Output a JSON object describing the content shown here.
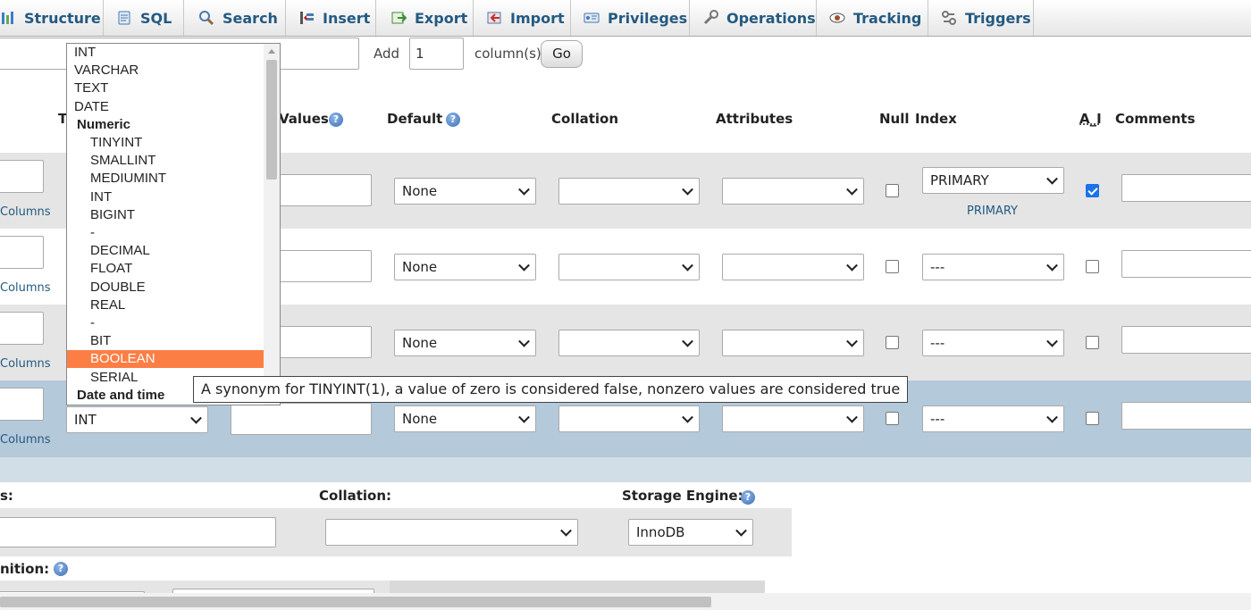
{
  "tabs": [
    {
      "label": "Structure",
      "icon": "structure-icon"
    },
    {
      "label": "SQL",
      "icon": "sql-icon"
    },
    {
      "label": "Search",
      "icon": "search-icon"
    },
    {
      "label": "Insert",
      "icon": "insert-icon"
    },
    {
      "label": "Export",
      "icon": "export-icon"
    },
    {
      "label": "Import",
      "icon": "import-icon"
    },
    {
      "label": "Privileges",
      "icon": "privileges-icon"
    },
    {
      "label": "Operations",
      "icon": "operations-icon"
    },
    {
      "label": "Tracking",
      "icon": "tracking-icon"
    },
    {
      "label": "Triggers",
      "icon": "triggers-icon"
    }
  ],
  "add_columns": {
    "label": "Add",
    "value": "1",
    "suffix": "column(s)",
    "go": "Go"
  },
  "headers": {
    "type": "T",
    "values": "Values",
    "default": "Default",
    "collation": "Collation",
    "attributes": "Attributes",
    "null": "Null",
    "index": "Index",
    "ai": "A_I",
    "comments": "Comments"
  },
  "rows": [
    {
      "link": "Columns",
      "default": "None",
      "index": "PRIMARY",
      "index_note": "PRIMARY",
      "ai": true
    },
    {
      "link": "Columns",
      "default": "None",
      "index": "---",
      "ai": false
    },
    {
      "link": "Columns",
      "default": "None",
      "index": "---",
      "ai": false
    },
    {
      "link": "Columns",
      "type": "INT",
      "default": "None",
      "index": "---",
      "ai": false
    }
  ],
  "dropdown": {
    "items": [
      {
        "label": "INT",
        "kind": "top"
      },
      {
        "label": "VARCHAR",
        "kind": "top"
      },
      {
        "label": "TEXT",
        "kind": "top"
      },
      {
        "label": "DATE",
        "kind": "top"
      },
      {
        "label": "Numeric",
        "kind": "group"
      },
      {
        "label": "TINYINT",
        "kind": "sub"
      },
      {
        "label": "SMALLINT",
        "kind": "sub"
      },
      {
        "label": "MEDIUMINT",
        "kind": "sub"
      },
      {
        "label": "INT",
        "kind": "sub"
      },
      {
        "label": "BIGINT",
        "kind": "sub"
      },
      {
        "label": "-",
        "kind": "sub"
      },
      {
        "label": "DECIMAL",
        "kind": "sub"
      },
      {
        "label": "FLOAT",
        "kind": "sub"
      },
      {
        "label": "DOUBLE",
        "kind": "sub"
      },
      {
        "label": "REAL",
        "kind": "sub"
      },
      {
        "label": "-",
        "kind": "sub"
      },
      {
        "label": "BIT",
        "kind": "sub"
      },
      {
        "label": "BOOLEAN",
        "kind": "sub",
        "highlighted": true
      },
      {
        "label": "SERIAL",
        "kind": "sub"
      },
      {
        "label": "Date and time",
        "kind": "group"
      }
    ]
  },
  "tooltip": "A synonym for TINYINT(1), a value of zero is considered false, nonzero values are considered true",
  "table_options": {
    "comments_label": "s:",
    "collation_label": "Collation:",
    "engine_label": "Storage Engine:",
    "engine_value": "InnoDB",
    "partition_label": "nition:"
  },
  "colors": {
    "accent": "#235a81",
    "highlight": "#fd7e45",
    "row_alt": "#e5e5e5",
    "row_selected": "#b4c9da"
  }
}
